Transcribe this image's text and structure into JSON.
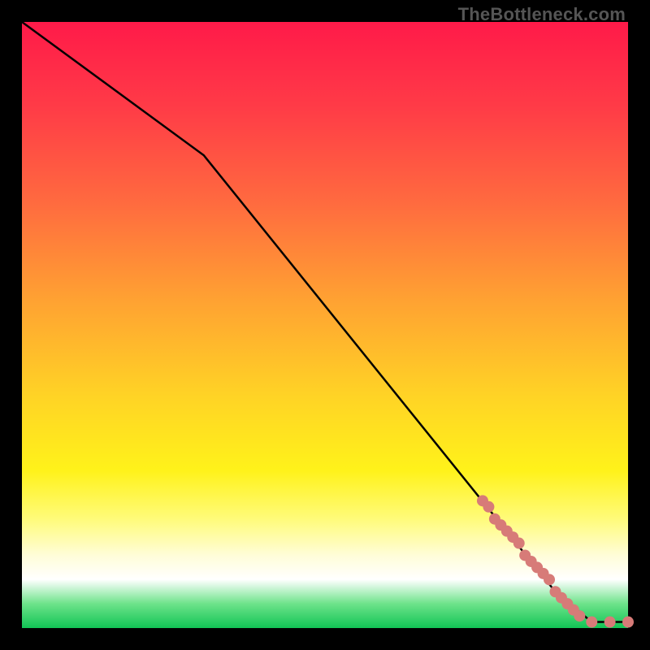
{
  "watermark": "TheBottleneck.com",
  "chart_data": {
    "type": "line",
    "title": "",
    "xlabel": "",
    "ylabel": "",
    "xlim": [
      0,
      100
    ],
    "ylim": [
      0,
      100
    ],
    "grid": false,
    "legend": false,
    "background_gradient": "vertical red→yellow→green (bottleneck severity)",
    "series": [
      {
        "name": "bottleneck-curve",
        "color": "#000000",
        "type": "line",
        "x": [
          0,
          30,
          88,
          94,
          100
        ],
        "values": [
          100,
          78,
          6,
          1,
          1
        ]
      },
      {
        "name": "data-points",
        "color": "#d77b78",
        "type": "scatter",
        "x": [
          76,
          77,
          78,
          79,
          80,
          81,
          82,
          83,
          84,
          85,
          86,
          87,
          88,
          89,
          90,
          91,
          92,
          94,
          97,
          100
        ],
        "values": [
          21,
          20,
          18,
          17,
          16,
          15,
          14,
          12,
          11,
          10,
          9,
          8,
          6,
          5,
          4,
          3,
          2,
          1,
          1,
          1
        ]
      }
    ]
  }
}
